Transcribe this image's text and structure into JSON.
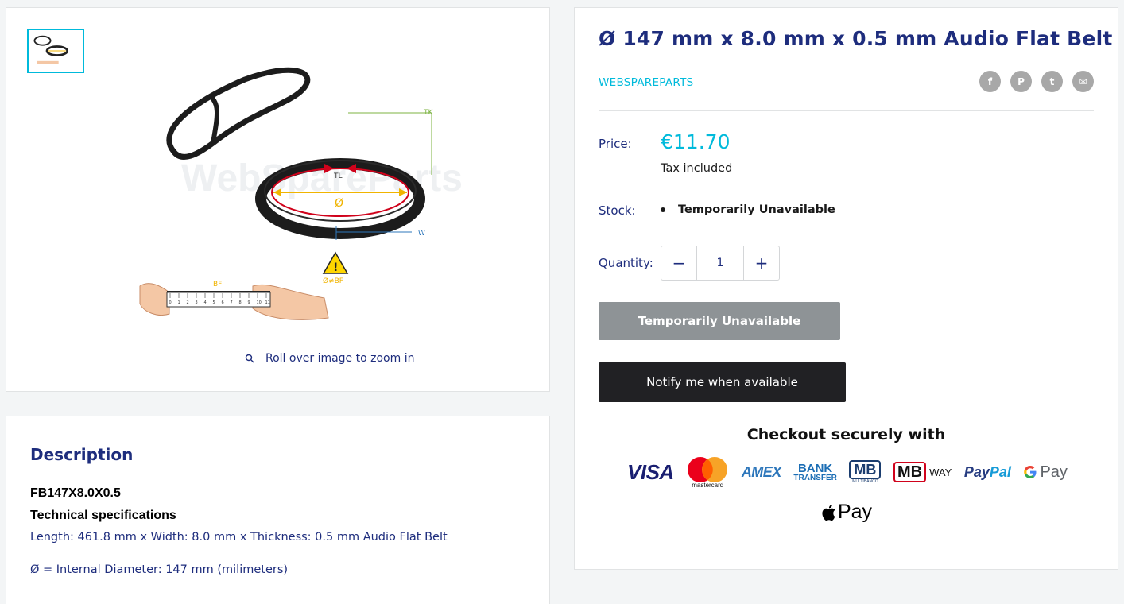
{
  "gallery": {
    "zoom_hint": "Roll over image to zoom in",
    "watermark": "WebSpareParts",
    "diagram_labels": {
      "tk": "TK",
      "tl": "TL",
      "diameter": "Ø",
      "w": "W",
      "bf": "BF",
      "warning": "Ø≠BF",
      "ruler_ticks": [
        "0",
        "1",
        "2",
        "3",
        "4",
        "5",
        "6",
        "7",
        "8",
        "9",
        "10",
        "11"
      ]
    }
  },
  "description": {
    "title": "Description",
    "sku": "FB147X8.0X0.5",
    "tech_heading": "Technical specifications",
    "line1": "Length: 461.8 mm x Width: 8.0 mm x Thickness: 0.5 mm Audio Flat Belt",
    "line2": "Ø = Internal Diameter: 147 mm (milimeters)"
  },
  "product": {
    "title": "Ø 147 mm x 8.0 mm x 0.5 mm Audio Flat Belt",
    "vendor": "WEBSPAREPARTS",
    "share_icons": [
      "facebook-icon",
      "pinterest-icon",
      "twitter-icon",
      "email-icon"
    ],
    "price_label": "Price:",
    "price": "€11.70",
    "tax_note": "Tax included",
    "stock_label": "Stock:",
    "stock_status": "Temporarily Unavailable",
    "quantity_label": "Quantity:",
    "quantity_value": "1",
    "minus": "−",
    "plus": "+",
    "unavailable_button": "Temporarily Unavailable",
    "notify_button": "Notify me when available"
  },
  "checkout": {
    "title": "Checkout securely with",
    "methods": {
      "visa": "VISA",
      "mastercard": "mastercard",
      "amex": "AMEX",
      "bank_1": "BANK",
      "bank_2": "TRANSFER",
      "multibanco_mb": "MB",
      "multibanco_sub": "MULTIBANCO",
      "mbway_mb": "MB",
      "mbway_way": "WAY",
      "paypal_1": "Pay",
      "paypal_2": "Pal",
      "gpay": "Pay",
      "applepay": "Pay"
    }
  },
  "colors": {
    "accent": "#00badb",
    "heading": "#1e2d7d",
    "disabled_button": "#8e9396",
    "dark_button": "#212124"
  }
}
